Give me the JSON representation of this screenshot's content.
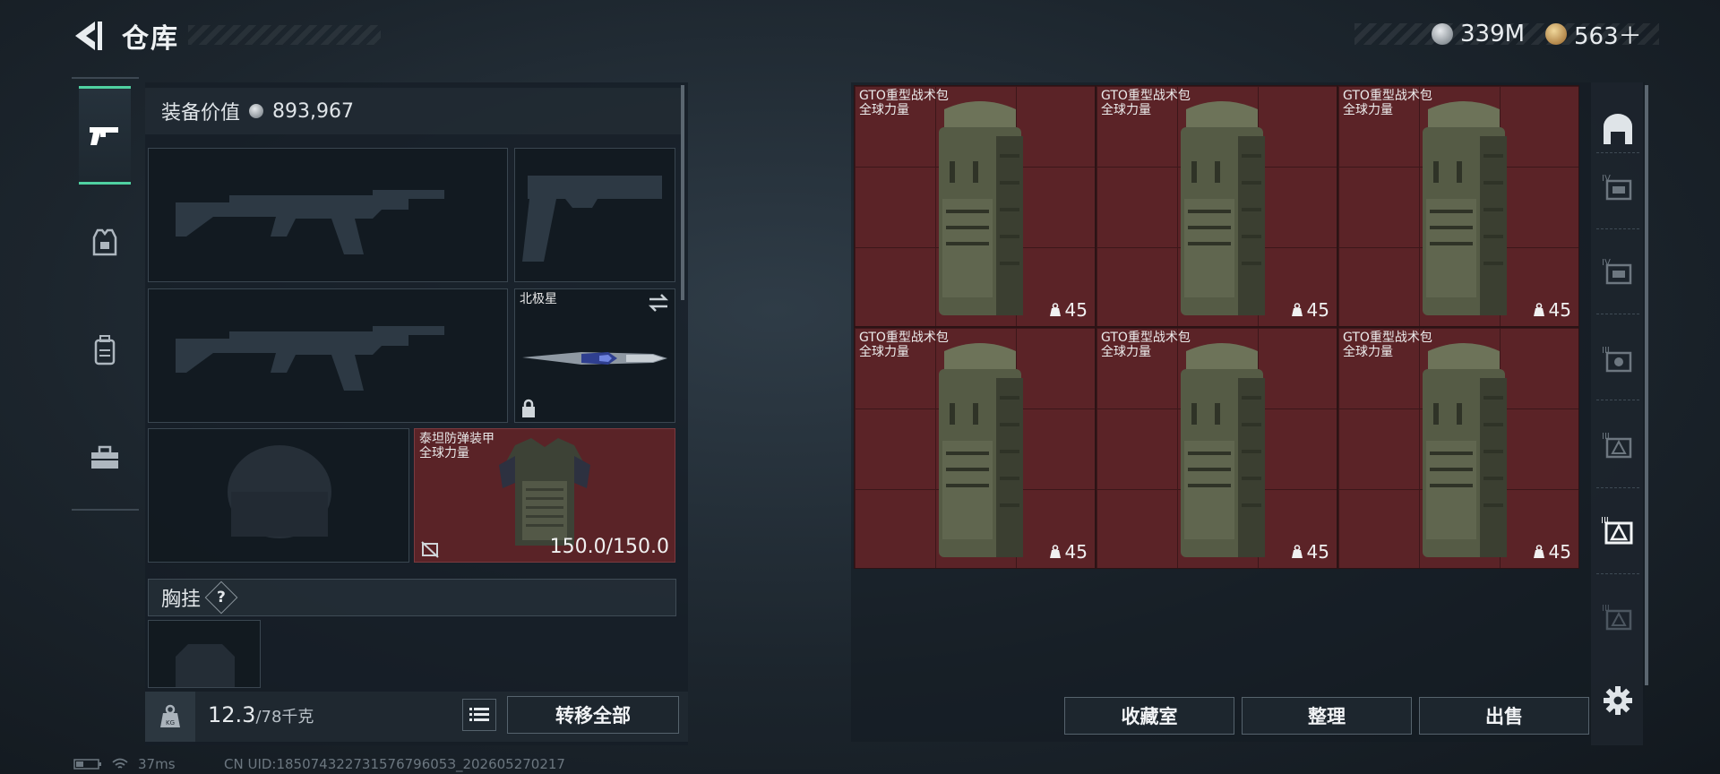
{
  "header": {
    "title": "仓库",
    "currencies": [
      {
        "icon": "silver-coin-icon",
        "value": "339M"
      },
      {
        "icon": "gold-coin-icon",
        "value": "563＋"
      }
    ]
  },
  "left_rail": {
    "items": [
      {
        "icon": "gun-icon",
        "active": true
      },
      {
        "icon": "armor-icon",
        "active": false
      },
      {
        "icon": "backpack-icon",
        "active": false
      },
      {
        "icon": "toolbox-icon",
        "active": false
      }
    ]
  },
  "equipment": {
    "value_label": "装备价值",
    "value": "893,967",
    "melee": {
      "name": "北极星"
    },
    "armor": {
      "name": "泰坦防弹装甲",
      "sub": "全球力量",
      "durability": "150.0/150.0"
    },
    "chest_rig_label": "胸挂",
    "chest_rig_help": "?",
    "weight_value": "12.3",
    "weight_max": "/78千克",
    "transfer_all": "转移全部"
  },
  "storage": {
    "items": [
      {
        "name": "GTO重型战术包",
        "sub": "全球力量",
        "count": "45"
      },
      {
        "name": "GTO重型战术包",
        "sub": "全球力量",
        "count": "45"
      },
      {
        "name": "GTO重型战术包",
        "sub": "全球力量",
        "count": "45"
      },
      {
        "name": "GTO重型战术包",
        "sub": "全球力量",
        "count": "45"
      },
      {
        "name": "GTO重型战术包",
        "sub": "全球力量",
        "count": "45"
      },
      {
        "name": "GTO重型战术包",
        "sub": "全球力量",
        "count": "45"
      }
    ],
    "buttons": {
      "vault": "收藏室",
      "sort": "整理",
      "sell": "出售"
    }
  },
  "status": {
    "ping": "37ms",
    "uid": "CN UID:18507432273157679605З_202605270217"
  }
}
